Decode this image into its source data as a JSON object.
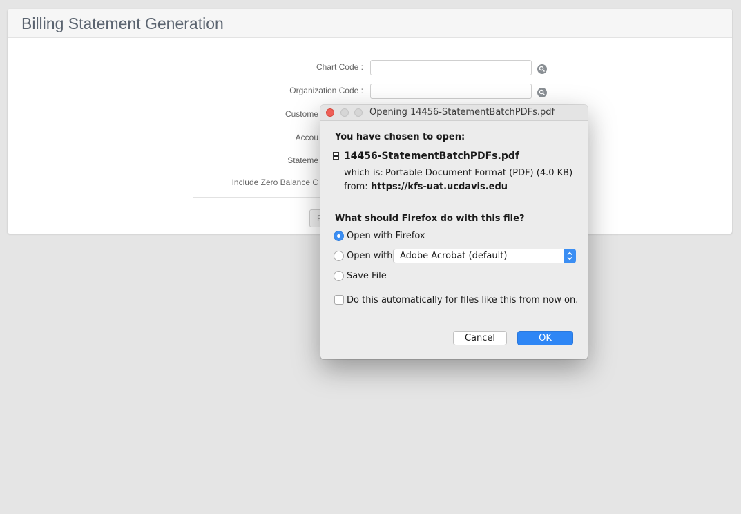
{
  "page": {
    "title": "Billing Statement Generation",
    "fields": [
      {
        "label": "Chart Code :"
      },
      {
        "label": "Organization Code :"
      },
      {
        "label": "Custome"
      },
      {
        "label": "Accou"
      },
      {
        "label": "Stateme"
      },
      {
        "label": "Include Zero Balance C"
      }
    ],
    "partial_button_label": "F"
  },
  "dialog": {
    "title": "Opening 14456-StatementBatchPDFs.pdf",
    "chosen_heading": "You have chosen to open:",
    "filename": "14456-StatementBatchPDFs.pdf",
    "which_is_label": "which is:",
    "which_is_value": "Portable Document Format (PDF) (4.0 KB)",
    "from_label": "from:",
    "from_value": "https://kfs-uat.ucdavis.edu",
    "question": "What should Firefox do with this file?",
    "options": [
      {
        "label": "Open with Firefox",
        "selected": true
      },
      {
        "label": "Open with",
        "selected": false
      },
      {
        "label": "Save File",
        "selected": false
      }
    ],
    "app_select_value": "Adobe Acrobat (default)",
    "auto_checkbox_label": "Do this automatically for files like this from now on.",
    "auto_checked": false,
    "cancel_label": "Cancel",
    "ok_label": "OK"
  },
  "icons": {
    "lookup": "magnifier-icon",
    "file": "pdf-file-icon"
  },
  "colors": {
    "accent": "#3b8ef3",
    "ok_button": "#2e86f5",
    "close_light": "#ee5f57",
    "background": "#e5e5e5"
  }
}
